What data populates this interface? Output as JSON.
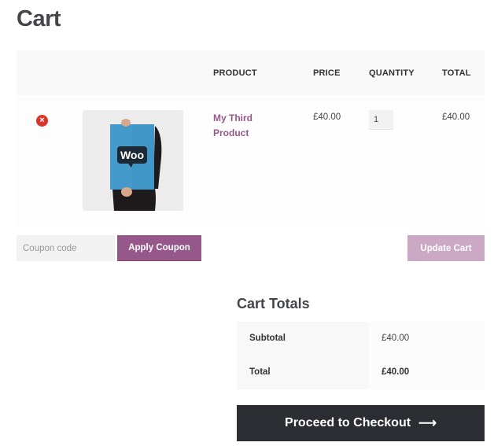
{
  "page": {
    "title": "Cart"
  },
  "cart_table": {
    "headers": {
      "remove": "",
      "thumbnail": "",
      "product": "PRODUCT",
      "price": "PRICE",
      "quantity": "QUANTITY",
      "total": "TOTAL"
    },
    "rows": [
      {
        "remove_icon": "×",
        "thumbnail_alt": "Woo poster",
        "thumbnail_text": "Woo",
        "product_name": "My Third Product",
        "price": "£40.00",
        "quantity": "1",
        "total": "£40.00"
      }
    ]
  },
  "actions": {
    "coupon_placeholder": "Coupon code",
    "coupon_value": "",
    "apply_coupon_label": "Apply Coupon",
    "update_cart_label": "Update Cart"
  },
  "cart_totals": {
    "title": "Cart Totals",
    "rows": [
      {
        "label": "Subtotal",
        "value": "£40.00"
      },
      {
        "label": "Total",
        "value": "£40.00"
      }
    ],
    "checkout_label": "Proceed to Checkout",
    "checkout_arrow": "⟶"
  },
  "colors": {
    "accent": "#96588a",
    "accent_disabled": "#cba8c4",
    "checkout_bg": "#2c2d33",
    "remove_icon": "#d9362b",
    "text": "#43454b"
  }
}
